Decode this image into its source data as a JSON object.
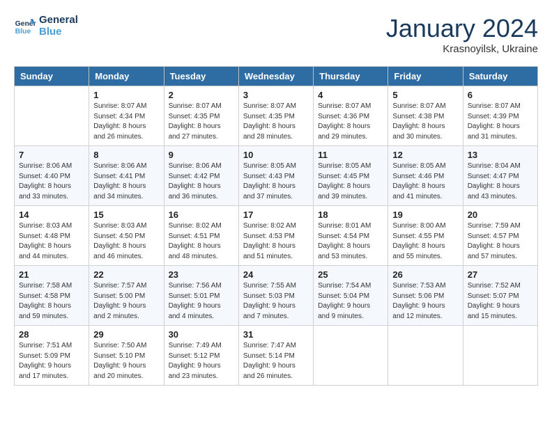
{
  "logo": {
    "line1": "General",
    "line2": "Blue"
  },
  "title": "January 2024",
  "location": "Krasnoyilsk, Ukraine",
  "weekdays": [
    "Sunday",
    "Monday",
    "Tuesday",
    "Wednesday",
    "Thursday",
    "Friday",
    "Saturday"
  ],
  "weeks": [
    [
      {
        "day": null,
        "sunrise": null,
        "sunset": null,
        "daylight": null
      },
      {
        "day": "1",
        "sunrise": "8:07 AM",
        "sunset": "4:34 PM",
        "daylight": "8 hours and 26 minutes."
      },
      {
        "day": "2",
        "sunrise": "8:07 AM",
        "sunset": "4:35 PM",
        "daylight": "8 hours and 27 minutes."
      },
      {
        "day": "3",
        "sunrise": "8:07 AM",
        "sunset": "4:35 PM",
        "daylight": "8 hours and 28 minutes."
      },
      {
        "day": "4",
        "sunrise": "8:07 AM",
        "sunset": "4:36 PM",
        "daylight": "8 hours and 29 minutes."
      },
      {
        "day": "5",
        "sunrise": "8:07 AM",
        "sunset": "4:38 PM",
        "daylight": "8 hours and 30 minutes."
      },
      {
        "day": "6",
        "sunrise": "8:07 AM",
        "sunset": "4:39 PM",
        "daylight": "8 hours and 31 minutes."
      }
    ],
    [
      {
        "day": "7",
        "sunrise": "8:06 AM",
        "sunset": "4:40 PM",
        "daylight": "8 hours and 33 minutes."
      },
      {
        "day": "8",
        "sunrise": "8:06 AM",
        "sunset": "4:41 PM",
        "daylight": "8 hours and 34 minutes."
      },
      {
        "day": "9",
        "sunrise": "8:06 AM",
        "sunset": "4:42 PM",
        "daylight": "8 hours and 36 minutes."
      },
      {
        "day": "10",
        "sunrise": "8:05 AM",
        "sunset": "4:43 PM",
        "daylight": "8 hours and 37 minutes."
      },
      {
        "day": "11",
        "sunrise": "8:05 AM",
        "sunset": "4:45 PM",
        "daylight": "8 hours and 39 minutes."
      },
      {
        "day": "12",
        "sunrise": "8:05 AM",
        "sunset": "4:46 PM",
        "daylight": "8 hours and 41 minutes."
      },
      {
        "day": "13",
        "sunrise": "8:04 AM",
        "sunset": "4:47 PM",
        "daylight": "8 hours and 43 minutes."
      }
    ],
    [
      {
        "day": "14",
        "sunrise": "8:03 AM",
        "sunset": "4:48 PM",
        "daylight": "8 hours and 44 minutes."
      },
      {
        "day": "15",
        "sunrise": "8:03 AM",
        "sunset": "4:50 PM",
        "daylight": "8 hours and 46 minutes."
      },
      {
        "day": "16",
        "sunrise": "8:02 AM",
        "sunset": "4:51 PM",
        "daylight": "8 hours and 48 minutes."
      },
      {
        "day": "17",
        "sunrise": "8:02 AM",
        "sunset": "4:53 PM",
        "daylight": "8 hours and 51 minutes."
      },
      {
        "day": "18",
        "sunrise": "8:01 AM",
        "sunset": "4:54 PM",
        "daylight": "8 hours and 53 minutes."
      },
      {
        "day": "19",
        "sunrise": "8:00 AM",
        "sunset": "4:55 PM",
        "daylight": "8 hours and 55 minutes."
      },
      {
        "day": "20",
        "sunrise": "7:59 AM",
        "sunset": "4:57 PM",
        "daylight": "8 hours and 57 minutes."
      }
    ],
    [
      {
        "day": "21",
        "sunrise": "7:58 AM",
        "sunset": "4:58 PM",
        "daylight": "8 hours and 59 minutes."
      },
      {
        "day": "22",
        "sunrise": "7:57 AM",
        "sunset": "5:00 PM",
        "daylight": "9 hours and 2 minutes."
      },
      {
        "day": "23",
        "sunrise": "7:56 AM",
        "sunset": "5:01 PM",
        "daylight": "9 hours and 4 minutes."
      },
      {
        "day": "24",
        "sunrise": "7:55 AM",
        "sunset": "5:03 PM",
        "daylight": "9 hours and 7 minutes."
      },
      {
        "day": "25",
        "sunrise": "7:54 AM",
        "sunset": "5:04 PM",
        "daylight": "9 hours and 9 minutes."
      },
      {
        "day": "26",
        "sunrise": "7:53 AM",
        "sunset": "5:06 PM",
        "daylight": "9 hours and 12 minutes."
      },
      {
        "day": "27",
        "sunrise": "7:52 AM",
        "sunset": "5:07 PM",
        "daylight": "9 hours and 15 minutes."
      }
    ],
    [
      {
        "day": "28",
        "sunrise": "7:51 AM",
        "sunset": "5:09 PM",
        "daylight": "9 hours and 17 minutes."
      },
      {
        "day": "29",
        "sunrise": "7:50 AM",
        "sunset": "5:10 PM",
        "daylight": "9 hours and 20 minutes."
      },
      {
        "day": "30",
        "sunrise": "7:49 AM",
        "sunset": "5:12 PM",
        "daylight": "9 hours and 23 minutes."
      },
      {
        "day": "31",
        "sunrise": "7:47 AM",
        "sunset": "5:14 PM",
        "daylight": "9 hours and 26 minutes."
      },
      {
        "day": null,
        "sunrise": null,
        "sunset": null,
        "daylight": null
      },
      {
        "day": null,
        "sunrise": null,
        "sunset": null,
        "daylight": null
      },
      {
        "day": null,
        "sunrise": null,
        "sunset": null,
        "daylight": null
      }
    ]
  ]
}
